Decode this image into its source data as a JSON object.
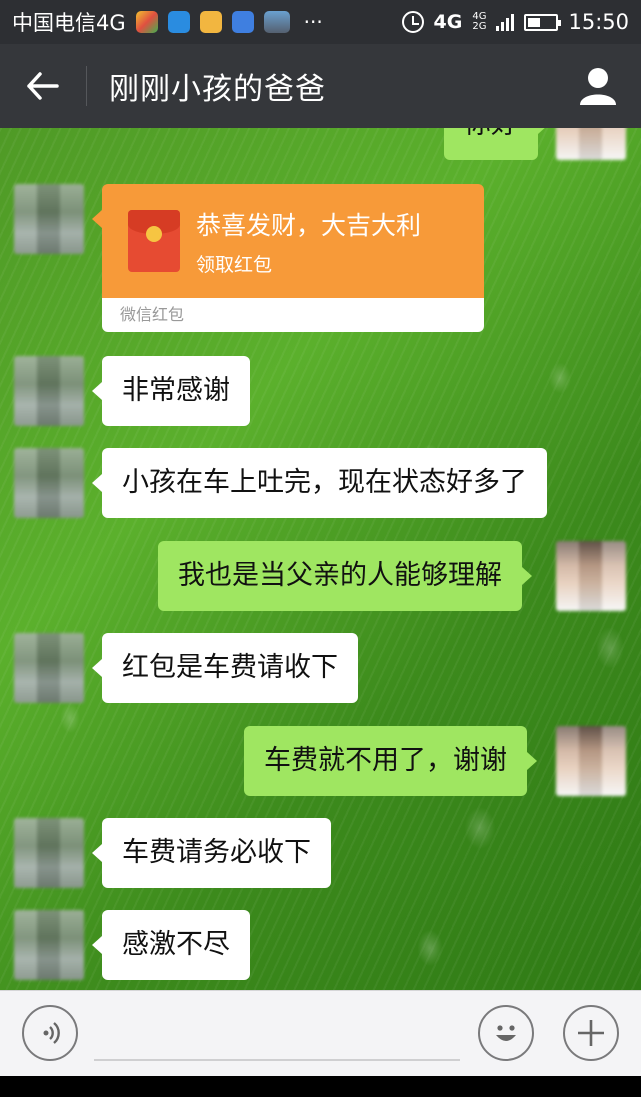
{
  "status_bar": {
    "carrier": "中国电信4G",
    "more": "···",
    "network": "4G",
    "network_small_top": "4G",
    "network_small_bottom": "2G",
    "time": "15:50"
  },
  "header": {
    "title": "刚刚小孩的爸爸"
  },
  "messages": [
    {
      "side": "right",
      "text": "你好"
    },
    {
      "side": "left",
      "type": "red_packet",
      "title": "恭喜发财，大吉大利",
      "subtitle": "领取红包",
      "footer": "微信红包"
    },
    {
      "side": "left",
      "text": "非常感谢"
    },
    {
      "side": "left",
      "text": "小孩在车上吐完，现在状态好多了"
    },
    {
      "side": "right",
      "text": "我也是当父亲的人能够理解"
    },
    {
      "side": "left",
      "text": "红包是车费请收下"
    },
    {
      "side": "right",
      "text": "车费就不用了，谢谢"
    },
    {
      "side": "left",
      "text": "车费请务必收下"
    },
    {
      "side": "left",
      "text": "感激不尽"
    }
  ],
  "input_bar": {
    "voice_icon": "voice-icon",
    "emoji_icon": "emoji-icon",
    "add_icon": "plus-icon"
  },
  "colors": {
    "header_bg": "#35373b",
    "bubble_mine": "#9fe661",
    "bubble_other": "#ffffff",
    "red_packet": "#f79a39"
  }
}
